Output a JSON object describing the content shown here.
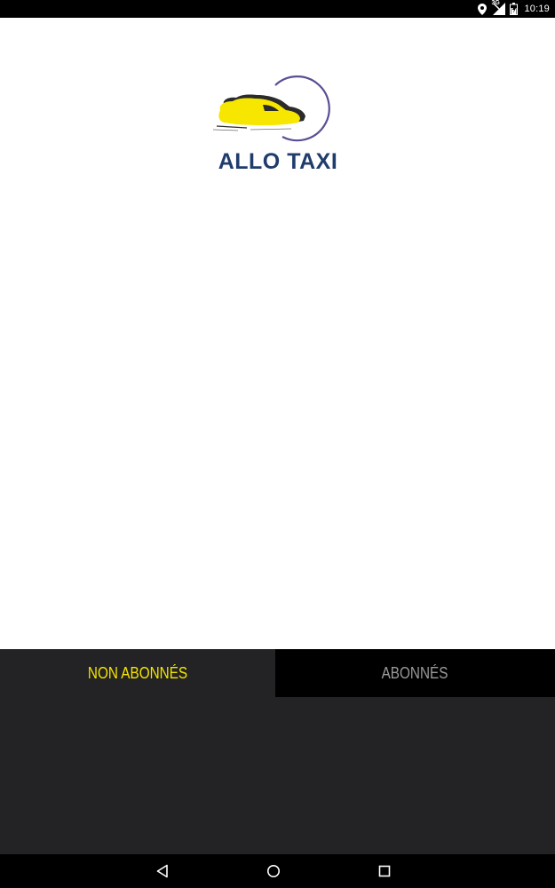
{
  "status_bar": {
    "time": "10:19",
    "network_label": "3G",
    "icons": [
      "location-icon",
      "signal-icon",
      "battery-icon"
    ]
  },
  "logo": {
    "text": "ALLO TAXI",
    "colors": {
      "text": "#1f3c6b",
      "car_fill": "#f6e600",
      "car_outline": "#2b2b2b",
      "ring": "#5a4e93"
    }
  },
  "tabs": [
    {
      "label": "NON ABONNÉS",
      "active": true
    },
    {
      "label": "ABONNÉS",
      "active": false
    }
  ],
  "colors": {
    "accent": "#f6e600",
    "inactive_tab_text": "#9a9a9a",
    "panel_bg": "#232224",
    "bar_bg": "#000000"
  },
  "nav_bar": {
    "buttons": [
      "back-icon",
      "home-icon",
      "recents-icon"
    ]
  }
}
